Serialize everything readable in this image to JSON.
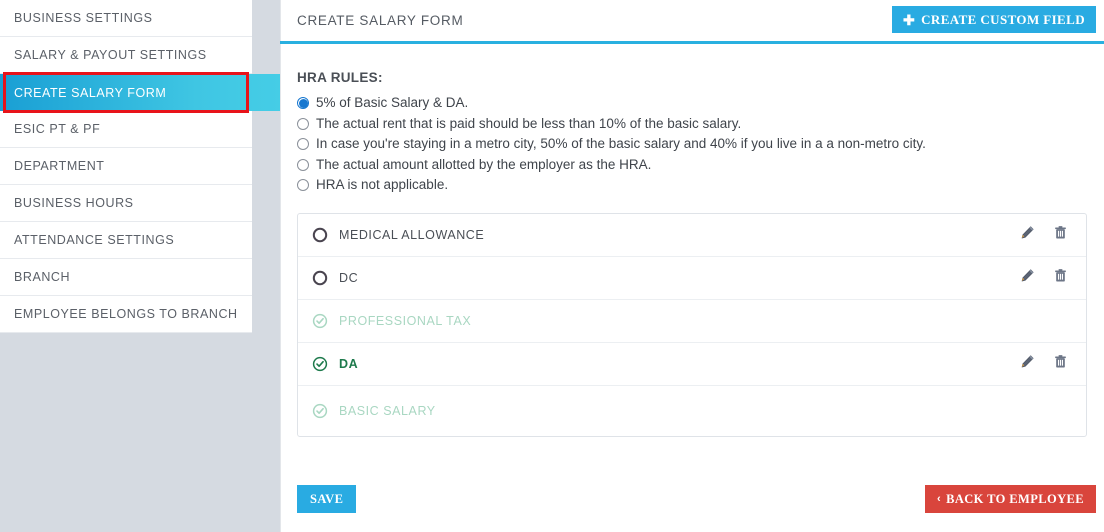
{
  "sidebar": {
    "items": [
      {
        "label": "BUSINESS SETTINGS",
        "active": false
      },
      {
        "label": "SALARY & PAYOUT SETTINGS",
        "active": false
      },
      {
        "label": "CREATE SALARY FORM",
        "active": true
      },
      {
        "label": "ESIC PT & PF",
        "active": false
      },
      {
        "label": "DEPARTMENT",
        "active": false
      },
      {
        "label": "BUSINESS HOURS",
        "active": false
      },
      {
        "label": "ATTENDANCE SETTINGS",
        "active": false
      },
      {
        "label": "BRANCH",
        "active": false
      },
      {
        "label": "EMPLOYEE BELONGS TO BRANCH",
        "active": false
      }
    ]
  },
  "header": {
    "title": "CREATE SALARY FORM",
    "create_custom_field_label": "CREATE CUSTOM FIELD",
    "plus_glyph": "✚"
  },
  "hra": {
    "title": "HRA RULES:",
    "rules": [
      {
        "label": "5% of Basic Salary & DA.",
        "selected": true
      },
      {
        "label": "The actual rent that is paid should be less than 10% of the basic salary.",
        "selected": false
      },
      {
        "label": "In case you're staying in a metro city, 50% of the basic salary and 40% if you live in a a non-metro city.",
        "selected": false
      },
      {
        "label": "The actual amount allotted by the employer as the HRA.",
        "selected": false
      },
      {
        "label": "HRA is not applicable.",
        "selected": false
      }
    ]
  },
  "components": [
    {
      "name": "MEDICAL ALLOWANCE",
      "state": "unchecked",
      "has_actions": true
    },
    {
      "name": "DC",
      "state": "unchecked",
      "has_actions": true
    },
    {
      "name": "PROFESSIONAL TAX",
      "state": "checked-faded",
      "has_actions": false
    },
    {
      "name": "DA",
      "state": "checked-active",
      "has_actions": true
    },
    {
      "name": "BASIC SALARY",
      "state": "checked-faded",
      "has_actions": false
    }
  ],
  "footer": {
    "save_label": "SAVE",
    "back_label": "BACK TO EMPLOYEE",
    "back_chevron": "‹"
  },
  "colors": {
    "accent_blue": "#29abe2",
    "sidebar_bg": "#d5dae1",
    "annotation_red": "#e8131a",
    "danger_red": "#d9453c",
    "green_active": "#1e7a4c",
    "green_faded": "#a9d7c2"
  }
}
